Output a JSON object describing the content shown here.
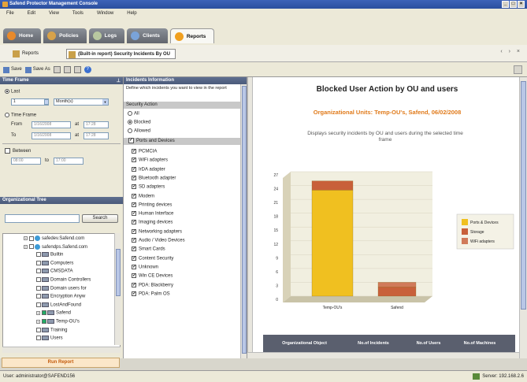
{
  "window": {
    "title": "Safend Protector Management Console"
  },
  "menu": [
    "File",
    "Edit",
    "View",
    "Tools",
    "Window",
    "Help"
  ],
  "main_tabs": [
    {
      "label": "Home",
      "color": "#e98a2b"
    },
    {
      "label": "Policies",
      "color": "#d7a24a"
    },
    {
      "label": "Logs",
      "color": "#b8c8a0"
    },
    {
      "label": "Clients",
      "color": "#7aa3d9"
    },
    {
      "label": "Reports",
      "color": "#f0a020",
      "active": true
    }
  ],
  "sub_tabs": {
    "reports": "Reports",
    "current": "(Built-in report) Security Incidents By OU"
  },
  "toolbar": {
    "save": "Save",
    "save_as": "Save As"
  },
  "time_frame": {
    "header": "Time Frame",
    "last_label": "Last",
    "last_value": "1",
    "last_unit": "Month(s)",
    "time_frame_label": "Time Frame",
    "from_label": "From",
    "from_date": "1/16/2008",
    "from_time": "17:28",
    "to_label": "To",
    "to_date": "1/16/2008",
    "to_time": "17:28",
    "at_label": "at",
    "between_label": "Between",
    "between_from": "08:00",
    "between_to_label": "to",
    "between_to": "17:00"
  },
  "org_tree": {
    "header": "Organizational Tree",
    "search_button": "Search",
    "items": [
      {
        "label": "safedev.Safend.com",
        "level": 0,
        "globe": true
      },
      {
        "label": "safendps.Safend.com",
        "level": 0,
        "globe": true
      },
      {
        "label": "Builtin",
        "level": 1
      },
      {
        "label": "Computers",
        "level": 1
      },
      {
        "label": "CMSDATA",
        "level": 1
      },
      {
        "label": "Domain Controllers",
        "level": 1
      },
      {
        "label": "Domain users for",
        "level": 1
      },
      {
        "label": "Encryption Anyw",
        "level": 1
      },
      {
        "label": "LostAndFound",
        "level": 1
      },
      {
        "label": "Safend",
        "level": 1,
        "checked": true
      },
      {
        "label": "Temp-OU's",
        "level": 1,
        "checked": true
      },
      {
        "label": "Training",
        "level": 1
      },
      {
        "label": "Users",
        "level": 1
      }
    ]
  },
  "run_report": "Run Report",
  "incidents": {
    "header": "Incidents Information",
    "description": "Define which incidents you want to view in the report",
    "security_action_header": "Security Action",
    "actions": [
      {
        "label": "All",
        "selected": false
      },
      {
        "label": "Blocked",
        "selected": true
      },
      {
        "label": "Allowed",
        "selected": false
      }
    ],
    "ports_header": "Ports and Devices",
    "ports": [
      "PCMCIA",
      "WiFi adapters",
      "IrDA adapter",
      "Bluetooth adapter",
      "SD adapters",
      "Modem",
      "Printing devices",
      "Human Interface",
      "Imaging devices",
      "Networking adapters",
      "Audio / Video Devices",
      "Smart Cards",
      "Content Security",
      "Unknown",
      "Win CE Devices",
      "PDA: Blackberry",
      "PDA: Palm OS"
    ]
  },
  "report": {
    "title": "Blocked User Action by OU and users",
    "subtitle": "Organizational Units: Temp-OU's, Safend, 06/02/2008",
    "description": "Displays security incidents by OU and users during the selected time frame",
    "table_headers": [
      "Organizational Object",
      "No.of Incidents",
      "No.of Users",
      "No.of Machines"
    ]
  },
  "chart_data": {
    "type": "bar",
    "stacked": true,
    "categories": [
      "Temp-OU's",
      "Safend"
    ],
    "series": [
      {
        "name": "Ports & Devices",
        "values": [
          23,
          0
        ],
        "color": "#f0c020"
      },
      {
        "name": "Storage",
        "values": [
          2,
          2
        ],
        "color": "#c8603a"
      },
      {
        "name": "WiFi adapters",
        "values": [
          0,
          1
        ],
        "color": "#d07a5a"
      }
    ],
    "yticks": [
      0,
      3,
      6,
      9,
      12,
      15,
      18,
      21,
      24,
      27
    ],
    "ylim": [
      0,
      27
    ]
  },
  "status": {
    "user": "User: administrator@SAFEND156",
    "server": "Server: 192.168.2.6"
  }
}
